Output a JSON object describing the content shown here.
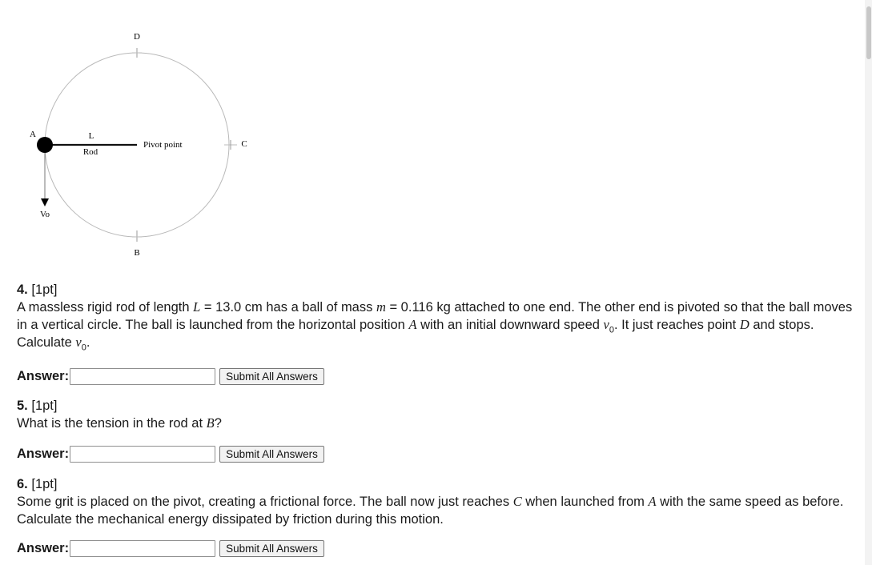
{
  "figure": {
    "label_d": "D",
    "label_a": "A",
    "label_l": "L",
    "label_rod": "Rod",
    "label_pivot": "Pivot point",
    "label_c": "C",
    "label_vo": "Vo",
    "label_b": "B"
  },
  "questions": [
    {
      "number": "4.",
      "points": "[1pt]",
      "text_parts": [
        "A massless rigid rod of length ",
        "L",
        " = 13.0 cm has a ball of mass ",
        "m",
        " = 0.116 kg attached to one end. The other end is pivoted so that the ball moves in a vertical circle. The ball is launched from the horizontal position ",
        "A",
        " with an initial downward speed ",
        "v",
        "0",
        ". It just reaches point ",
        "D",
        " and stops. Calculate ",
        "v",
        "0",
        "."
      ],
      "answer_label": "Answer:",
      "answer_value": "",
      "submit_label": "Submit All Answers"
    },
    {
      "number": "5.",
      "points": "[1pt]",
      "text_parts": [
        "What is the tension in the rod at ",
        "B",
        "?"
      ],
      "answer_label": "Answer:",
      "answer_value": "",
      "submit_label": "Submit All Answers"
    },
    {
      "number": "6.",
      "points": "[1pt]",
      "text_parts": [
        "Some grit is placed on the pivot, creating a frictional force. The ball now just reaches ",
        "C",
        " when launched from ",
        "A",
        " with the same speed as before. Calculate the mechanical energy dissipated by friction during this motion."
      ],
      "answer_label": "Answer:",
      "answer_value": "",
      "submit_label": "Submit All Answers"
    }
  ]
}
